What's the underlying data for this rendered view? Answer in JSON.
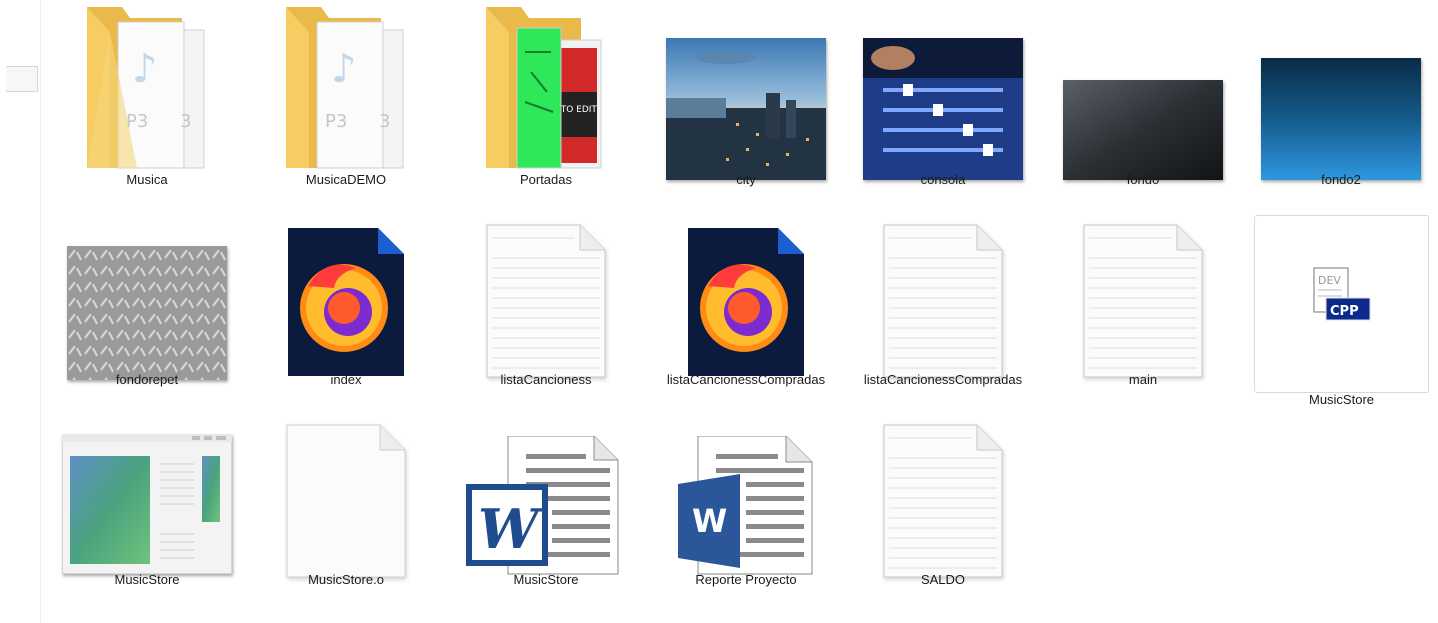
{
  "files": [
    {
      "name": "Musica",
      "icon": "folder-music-icon"
    },
    {
      "name": "MusicaDEMO",
      "icon": "folder-music-icon"
    },
    {
      "name": "Portadas",
      "icon": "folder-images-icon"
    },
    {
      "name": "city",
      "icon": "city-image-thumbnail"
    },
    {
      "name": "consola",
      "icon": "mixing-console-image-thumbnail"
    },
    {
      "name": "fondo",
      "icon": "dark-gradient-image-thumbnail"
    },
    {
      "name": "fondo2",
      "icon": "blue-gradient-image-thumbnail"
    },
    {
      "name": "fondorepet",
      "icon": "metal-plate-image-thumbnail"
    },
    {
      "name": "index",
      "icon": "firefox-document-icon"
    },
    {
      "name": "listaCancioness",
      "icon": "text-document-icon"
    },
    {
      "name": "listaCancionessCompradas",
      "icon": "firefox-document-icon"
    },
    {
      "name": "listaCancionessCompradas",
      "icon": "text-document-icon"
    },
    {
      "name": "main",
      "icon": "text-document-icon"
    },
    {
      "name": "MusicStore",
      "icon": "devcpp-file-icon",
      "badge": "CPP",
      "selected": true
    },
    {
      "name": "MusicStore",
      "icon": "application-window-icon"
    },
    {
      "name": "MusicStore.o",
      "icon": "blank-file-icon"
    },
    {
      "name": "MusicStore",
      "icon": "word-legacy-document-icon",
      "letter": "W"
    },
    {
      "name": "Reporte Proyecto",
      "icon": "word-document-icon",
      "letter": "W"
    },
    {
      "name": "SALDO",
      "icon": "text-document-icon"
    }
  ],
  "colors": {
    "folder": "#f5cd62",
    "word_blue": "#2b579a",
    "word_legacy_blue": "#1f4c8f",
    "firefox_bg": "#0b1a3d",
    "firefox_corner": "#1d5fd1",
    "cpp_badge": "#0b2a8c"
  }
}
